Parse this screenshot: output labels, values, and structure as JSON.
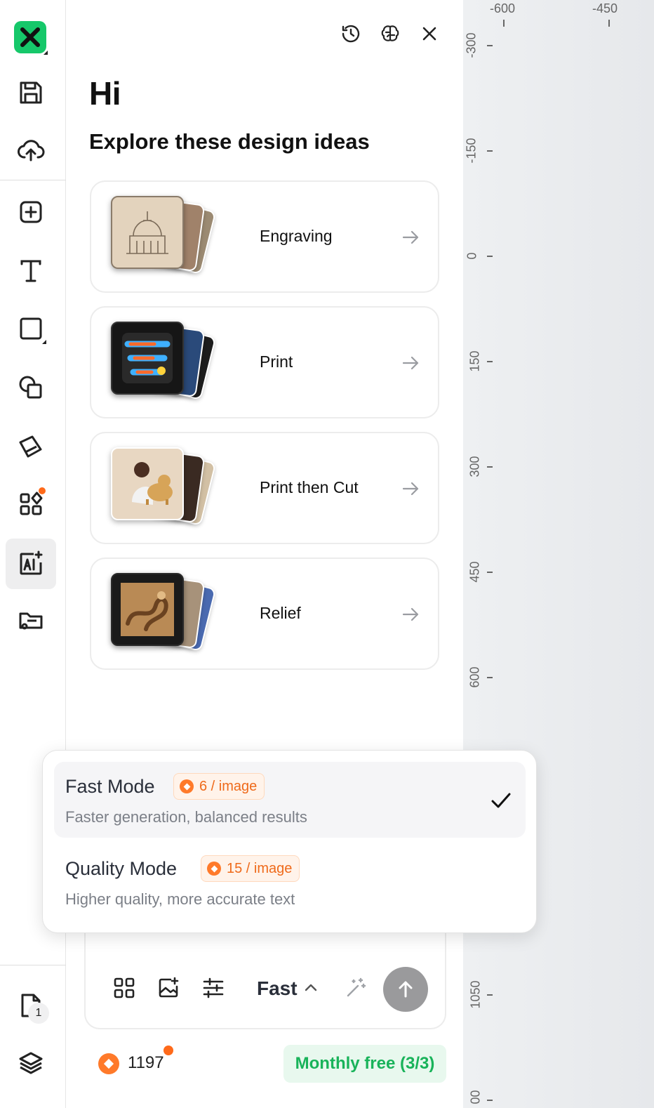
{
  "toolbar": {
    "items": [
      {
        "name": "save",
        "icon": "save-icon"
      },
      {
        "name": "upload",
        "icon": "cloud-upload-icon"
      },
      {
        "name": "add",
        "icon": "plus-square-icon"
      },
      {
        "name": "text",
        "icon": "text-icon"
      },
      {
        "name": "shape",
        "icon": "square-icon"
      },
      {
        "name": "copy",
        "icon": "copy-shapes-icon"
      },
      {
        "name": "materials",
        "icon": "materials-icon"
      },
      {
        "name": "apps",
        "icon": "apps-icon"
      },
      {
        "name": "ai",
        "icon": "ai-image-icon"
      },
      {
        "name": "folder",
        "icon": "folder-icon"
      }
    ],
    "page_count": "1"
  },
  "panel": {
    "greeting": "Hi",
    "subtitle": "Explore these design ideas",
    "cards": [
      {
        "label": "Engraving"
      },
      {
        "label": "Print"
      },
      {
        "label": "Print then Cut"
      },
      {
        "label": "Relief"
      }
    ]
  },
  "ruler": {
    "top_labels": [
      "-600",
      "-450"
    ],
    "side_labels": [
      "-300",
      "-150",
      "0",
      "150",
      "300",
      "450",
      "600",
      "1050",
      "00"
    ]
  },
  "modes": [
    {
      "title": "Fast Mode",
      "cost": "6 / image",
      "description": "Faster generation, balanced results",
      "selected": true
    },
    {
      "title": "Quality Mode",
      "cost": "15 / image",
      "description": "Higher quality, more accurate text",
      "selected": false
    }
  ],
  "input": {
    "mode_label": "Fast"
  },
  "footer": {
    "credits": "1197",
    "monthly": "Monthly free (3/3)"
  },
  "colors": {
    "brand": "#16c86a",
    "accent_orange": "#ff7a2a",
    "success_green": "#19b35a"
  }
}
